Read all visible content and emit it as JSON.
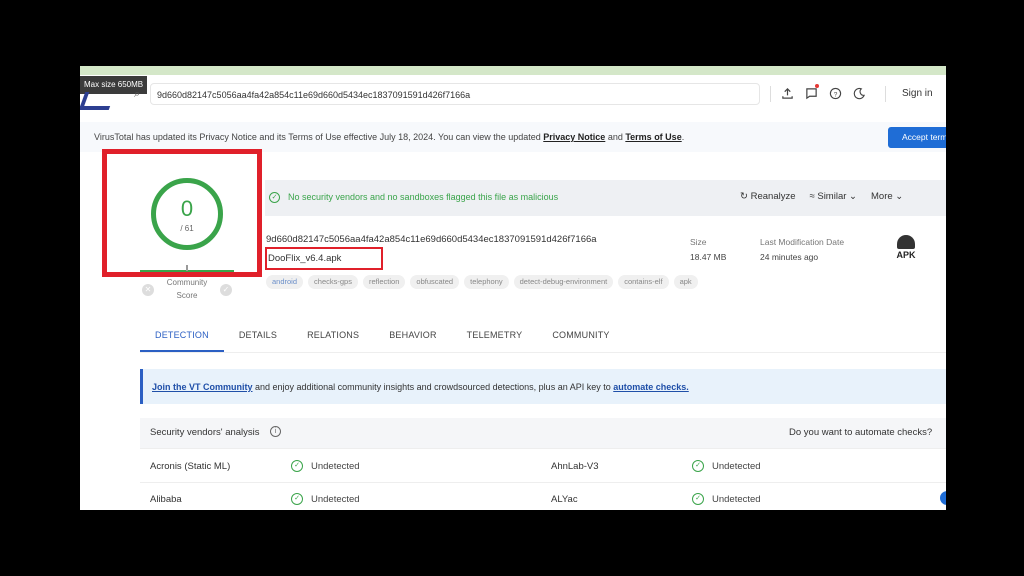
{
  "browser": {
    "tooltip": "Max size 650MB",
    "search_value": "9d660d82147c5056aa4fa42a854c11e69d660d5434ec1837091591d426f7166a",
    "sign_in": "Sign in"
  },
  "notice": {
    "text_before": "VirusTotal has updated its Privacy Notice and its Terms of Use effective July 18, 2024. You can view the updated ",
    "privacy_link": "Privacy Notice",
    "and": " and ",
    "terms_link": "Terms of Use",
    "end": ".",
    "accept_button": "Accept terms"
  },
  "score": {
    "detections": "0",
    "total": "/ 61",
    "community_label": "Community Score"
  },
  "status": {
    "message": "No security vendors and no sandboxes flagged this file as malicious",
    "reanalyze": "Reanalyze",
    "similar": "Similar",
    "more": "More"
  },
  "file": {
    "hash": "9d660d82147c5056aa4fa42a854c11e69d660d5434ec1837091591d426f7166a",
    "name": "DooFlix_v6.4.apk",
    "size_label": "Size",
    "size_value": "18.47 MB",
    "modified_label": "Last Modification Date",
    "modified_value": "24 minutes ago",
    "type_label": "APK",
    "tags": [
      "android",
      "checks-gps",
      "reflection",
      "obfuscated",
      "telephony",
      "detect-debug-environment",
      "contains-elf",
      "apk"
    ]
  },
  "tabs": [
    "DETECTION",
    "DETAILS",
    "RELATIONS",
    "BEHAVIOR",
    "TELEMETRY",
    "COMMUNITY"
  ],
  "banner": {
    "link1": "Join the VT Community",
    "middle": " and enjoy additional community insights and crowdsourced detections, plus an API key to ",
    "link2": "automate checks."
  },
  "analysis": {
    "title": "Security vendors' analysis",
    "question": "Do you want to automate checks?",
    "rows": [
      {
        "left_vendor": "Acronis (Static ML)",
        "left_result": "Undetected",
        "right_vendor": "AhnLab-V3",
        "right_result": "Undetected"
      },
      {
        "left_vendor": "Alibaba",
        "left_result": "Undetected",
        "right_vendor": "ALYac",
        "right_result": "Undetected"
      }
    ]
  },
  "colors": {
    "accent_blue": "#2b5fc3",
    "ok_green": "#3aa44a",
    "highlight_red": "#e0202a"
  }
}
